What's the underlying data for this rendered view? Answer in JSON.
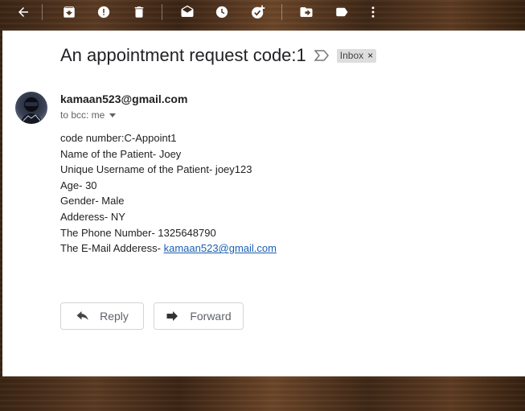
{
  "toolbar": {
    "icons": [
      "back-arrow-icon",
      "archive-icon",
      "report-spam-icon",
      "delete-icon",
      "mark-unread-icon",
      "snooze-icon",
      "add-to-tasks-icon",
      "move-to-icon",
      "labels-icon",
      "more-vert-icon"
    ]
  },
  "email": {
    "subject": "An appointment request code:1",
    "label": "Inbox",
    "label_close": "×",
    "sender": "kamaan523@gmail.com",
    "recipients": "to bcc: me",
    "body": {
      "line1": "code number:C-Appoint1",
      "line2": "Name of the Patient- Joey",
      "line3": "Unique Username of the Patient- joey123",
      "line4": "Age- 30",
      "line5": "Gender- Male",
      "line6": "Adderess- NY",
      "line7": "The Phone Number- 1325648790",
      "line8_prefix": "The E-Mail Adderess- ",
      "line8_link": "kamaan523@gmail.com"
    }
  },
  "actions": {
    "reply": "Reply",
    "forward": "Forward"
  },
  "colors": {
    "panel_bg": "#ffffff",
    "link": "#1a5fb4",
    "toolbar_icon": "#ffffff"
  }
}
